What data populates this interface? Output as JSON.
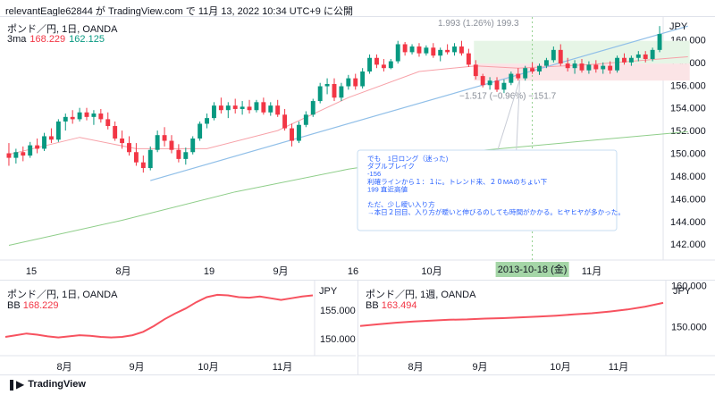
{
  "header": {
    "publish_line": "relevantEagle62844 が TradingView.com で 11月 13, 2022 10:34 UTC+9 に公開"
  },
  "main_pane": {
    "title": "ポンド／円, 1日, OANDA",
    "indicator_name": "3ma",
    "indicator_val1": "168.229",
    "indicator_val2": "162.125",
    "currency": "JPY",
    "measure_top": "1.993 (1.26%) 199.3",
    "measure_bottom": "−1.517 (−0.96%) −151.7",
    "crosshair_date": "2013-10-18 (金)",
    "note_lines": [
      "でも　1日ロング（迷った)",
      "ダブルブレイク",
      "-156",
      "利確ラインから１：１に。トレンド来、２０MAのちょい下",
      "199 直近高値",
      "",
      "ただ、少し曖い入り方",
      "→本日２回目、入り方が曖いと伸びるのしても時間がかかる。ヒヤヒヤが多かった。"
    ]
  },
  "sub_pane_left": {
    "title": "ポンド／円, 1日, OANDA",
    "indicator_name": "BB",
    "indicator_val": "168.229",
    "currency": "JPY"
  },
  "sub_pane_right": {
    "title": "ポンド／円, 1週, OANDA",
    "indicator_name": "BB",
    "indicator_val": "163.494",
    "currency": "JPY"
  },
  "footer": {
    "brand": "TradingView"
  },
  "colors": {
    "up": "#089981",
    "down": "#f23645",
    "ma_red": "#f7a1a8",
    "ma_green": "#8fce8a",
    "trend": "#90bfe8",
    "rect_green": "#e6f5e6",
    "rect_red": "#fbe4e6"
  },
  "chart_data": [
    {
      "type": "candlestick",
      "pane": "main",
      "y_axis": {
        "ticks": [
          142.0,
          144.0,
          146.0,
          148.0,
          150.0,
          152.0,
          154.0,
          156.0,
          158.0,
          160.0
        ],
        "range": [
          140.6,
          162.0
        ]
      },
      "x_tick_labels": [
        "15",
        "8月",
        "19",
        "9月",
        "16",
        "10月",
        "11月"
      ],
      "candles": [
        {
          "o": 150.0,
          "h": 150.9,
          "l": 148.9,
          "c": 149.6
        },
        {
          "o": 149.6,
          "h": 150.4,
          "l": 149.1,
          "c": 150.1
        },
        {
          "o": 150.1,
          "h": 150.6,
          "l": 149.3,
          "c": 149.8
        },
        {
          "o": 149.8,
          "h": 151.0,
          "l": 149.6,
          "c": 150.7
        },
        {
          "o": 150.7,
          "h": 151.3,
          "l": 150.0,
          "c": 150.4
        },
        {
          "o": 150.4,
          "h": 151.8,
          "l": 150.2,
          "c": 151.5
        },
        {
          "o": 151.5,
          "h": 152.2,
          "l": 150.9,
          "c": 151.2
        },
        {
          "o": 151.2,
          "h": 153.0,
          "l": 151.0,
          "c": 152.8
        },
        {
          "o": 152.8,
          "h": 153.5,
          "l": 152.0,
          "c": 153.2
        },
        {
          "o": 153.2,
          "h": 153.8,
          "l": 152.6,
          "c": 153.0
        },
        {
          "o": 153.0,
          "h": 154.0,
          "l": 152.8,
          "c": 153.6
        },
        {
          "o": 153.6,
          "h": 154.0,
          "l": 152.9,
          "c": 153.2
        },
        {
          "o": 153.2,
          "h": 153.8,
          "l": 152.5,
          "c": 153.5
        },
        {
          "o": 153.5,
          "h": 153.9,
          "l": 152.7,
          "c": 153.0
        },
        {
          "o": 153.0,
          "h": 153.6,
          "l": 152.1,
          "c": 152.4
        },
        {
          "o": 152.4,
          "h": 152.8,
          "l": 151.1,
          "c": 151.3
        },
        {
          "o": 151.3,
          "h": 152.0,
          "l": 150.4,
          "c": 150.9
        },
        {
          "o": 150.9,
          "h": 151.5,
          "l": 149.8,
          "c": 150.1
        },
        {
          "o": 150.1,
          "h": 150.9,
          "l": 148.9,
          "c": 149.2
        },
        {
          "o": 149.2,
          "h": 149.8,
          "l": 148.3,
          "c": 148.7
        },
        {
          "o": 148.7,
          "h": 150.6,
          "l": 148.5,
          "c": 150.3
        },
        {
          "o": 150.3,
          "h": 152.0,
          "l": 150.1,
          "c": 151.6
        },
        {
          "o": 151.6,
          "h": 152.3,
          "l": 150.6,
          "c": 151.1
        },
        {
          "o": 151.1,
          "h": 151.6,
          "l": 150.0,
          "c": 150.3
        },
        {
          "o": 150.3,
          "h": 150.8,
          "l": 149.2,
          "c": 149.5
        },
        {
          "o": 149.5,
          "h": 150.5,
          "l": 149.0,
          "c": 150.1
        },
        {
          "o": 150.1,
          "h": 151.5,
          "l": 149.9,
          "c": 151.3
        },
        {
          "o": 151.3,
          "h": 152.8,
          "l": 151.1,
          "c": 152.6
        },
        {
          "o": 152.6,
          "h": 153.5,
          "l": 152.2,
          "c": 153.1
        },
        {
          "o": 153.1,
          "h": 154.5,
          "l": 152.9,
          "c": 154.2
        },
        {
          "o": 154.2,
          "h": 154.9,
          "l": 153.5,
          "c": 153.8
        },
        {
          "o": 153.8,
          "h": 154.5,
          "l": 153.1,
          "c": 154.2
        },
        {
          "o": 154.2,
          "h": 154.8,
          "l": 153.5,
          "c": 153.9
        },
        {
          "o": 153.9,
          "h": 154.6,
          "l": 153.4,
          "c": 154.1
        },
        {
          "o": 154.1,
          "h": 154.7,
          "l": 153.5,
          "c": 153.8
        },
        {
          "o": 153.8,
          "h": 154.7,
          "l": 153.6,
          "c": 154.5
        },
        {
          "o": 154.5,
          "h": 154.9,
          "l": 153.4,
          "c": 153.6
        },
        {
          "o": 153.6,
          "h": 154.5,
          "l": 153.3,
          "c": 154.2
        },
        {
          "o": 154.2,
          "h": 154.7,
          "l": 153.2,
          "c": 153.4
        },
        {
          "o": 153.4,
          "h": 153.9,
          "l": 152.0,
          "c": 152.2
        },
        {
          "o": 152.2,
          "h": 152.6,
          "l": 150.6,
          "c": 151.1
        },
        {
          "o": 151.1,
          "h": 152.8,
          "l": 150.9,
          "c": 152.5
        },
        {
          "o": 152.5,
          "h": 153.7,
          "l": 152.3,
          "c": 153.4
        },
        {
          "o": 153.4,
          "h": 154.8,
          "l": 153.2,
          "c": 154.6
        },
        {
          "o": 154.6,
          "h": 156.2,
          "l": 154.4,
          "c": 155.9
        },
        {
          "o": 155.9,
          "h": 156.6,
          "l": 155.2,
          "c": 156.1
        },
        {
          "o": 156.1,
          "h": 156.6,
          "l": 154.6,
          "c": 154.9
        },
        {
          "o": 154.9,
          "h": 156.2,
          "l": 154.6,
          "c": 155.9
        },
        {
          "o": 155.9,
          "h": 156.9,
          "l": 155.6,
          "c": 156.6
        },
        {
          "o": 156.6,
          "h": 157.0,
          "l": 155.6,
          "c": 155.9
        },
        {
          "o": 155.9,
          "h": 157.5,
          "l": 155.7,
          "c": 157.2
        },
        {
          "o": 157.2,
          "h": 158.7,
          "l": 157.0,
          "c": 158.4
        },
        {
          "o": 158.4,
          "h": 158.7,
          "l": 157.5,
          "c": 157.8
        },
        {
          "o": 157.8,
          "h": 158.3,
          "l": 157.2,
          "c": 157.5
        },
        {
          "o": 157.5,
          "h": 158.3,
          "l": 157.4,
          "c": 158.1
        },
        {
          "o": 158.1,
          "h": 159.9,
          "l": 157.9,
          "c": 159.6
        },
        {
          "o": 159.6,
          "h": 159.8,
          "l": 158.6,
          "c": 158.9
        },
        {
          "o": 158.9,
          "h": 159.6,
          "l": 158.7,
          "c": 159.4
        },
        {
          "o": 159.4,
          "h": 159.7,
          "l": 158.5,
          "c": 158.8
        },
        {
          "o": 158.8,
          "h": 159.5,
          "l": 158.6,
          "c": 159.3
        },
        {
          "o": 159.3,
          "h": 159.7,
          "l": 158.4,
          "c": 158.6
        },
        {
          "o": 158.6,
          "h": 159.3,
          "l": 158.1,
          "c": 159.1
        },
        {
          "o": 159.1,
          "h": 159.6,
          "l": 158.7,
          "c": 158.9
        },
        {
          "o": 158.9,
          "h": 159.7,
          "l": 158.6,
          "c": 159.4
        },
        {
          "o": 159.4,
          "h": 159.9,
          "l": 158.6,
          "c": 158.8
        },
        {
          "o": 158.8,
          "h": 159.2,
          "l": 157.6,
          "c": 157.8
        },
        {
          "o": 157.8,
          "h": 158.2,
          "l": 156.5,
          "c": 156.8
        },
        {
          "o": 156.8,
          "h": 157.0,
          "l": 155.8,
          "c": 156.0
        },
        {
          "o": 156.0,
          "h": 156.7,
          "l": 155.6,
          "c": 156.4
        },
        {
          "o": 156.4,
          "h": 156.7,
          "l": 155.4,
          "c": 155.6
        },
        {
          "o": 155.6,
          "h": 156.5,
          "l": 155.3,
          "c": 156.2
        },
        {
          "o": 156.2,
          "h": 157.2,
          "l": 156.0,
          "c": 157.0
        },
        {
          "o": 157.0,
          "h": 157.5,
          "l": 156.4,
          "c": 156.6
        },
        {
          "o": 156.6,
          "h": 157.7,
          "l": 156.4,
          "c": 157.5
        },
        {
          "o": 157.5,
          "h": 158.0,
          "l": 157.0,
          "c": 157.2
        },
        {
          "o": 157.2,
          "h": 157.9,
          "l": 156.9,
          "c": 157.7
        },
        {
          "o": 157.7,
          "h": 158.4,
          "l": 157.5,
          "c": 158.2
        },
        {
          "o": 158.2,
          "h": 159.4,
          "l": 158.0,
          "c": 159.1
        },
        {
          "o": 159.1,
          "h": 159.6,
          "l": 157.7,
          "c": 157.9
        },
        {
          "o": 157.9,
          "h": 158.4,
          "l": 157.2,
          "c": 157.5
        },
        {
          "o": 157.5,
          "h": 158.2,
          "l": 157.0,
          "c": 157.9
        },
        {
          "o": 157.9,
          "h": 158.3,
          "l": 157.1,
          "c": 157.3
        },
        {
          "o": 157.3,
          "h": 158.1,
          "l": 157.0,
          "c": 157.8
        },
        {
          "o": 157.8,
          "h": 158.2,
          "l": 157.1,
          "c": 157.4
        },
        {
          "o": 157.4,
          "h": 158.0,
          "l": 157.0,
          "c": 157.7
        },
        {
          "o": 157.7,
          "h": 158.1,
          "l": 157.0,
          "c": 157.3
        },
        {
          "o": 157.3,
          "h": 158.6,
          "l": 157.1,
          "c": 158.4
        },
        {
          "o": 158.4,
          "h": 158.8,
          "l": 157.8,
          "c": 158.0
        },
        {
          "o": 158.0,
          "h": 158.6,
          "l": 157.7,
          "c": 158.4
        },
        {
          "o": 158.4,
          "h": 159.0,
          "l": 158.1,
          "c": 158.7
        },
        {
          "o": 158.7,
          "h": 159.0,
          "l": 158.0,
          "c": 158.3
        },
        {
          "o": 158.3,
          "h": 159.3,
          "l": 158.1,
          "c": 159.1
        },
        {
          "o": 159.1,
          "h": 161.2,
          "l": 158.9,
          "c": 160.5
        }
      ],
      "ma_red": [
        [
          0,
          149.9
        ],
        [
          10,
          151.4
        ],
        [
          18,
          150.4
        ],
        [
          28,
          150.4
        ],
        [
          38,
          152.0
        ],
        [
          48,
          154.9
        ],
        [
          58,
          157.2
        ],
        [
          66,
          157.7
        ],
        [
          72,
          157.5
        ],
        [
          82,
          157.8
        ],
        [
          92,
          158.3
        ],
        [
          96,
          158.5
        ]
      ],
      "ma_green": [
        [
          0,
          141.9
        ],
        [
          16,
          144.1
        ],
        [
          32,
          146.6
        ],
        [
          48,
          148.6
        ],
        [
          64,
          150.1
        ],
        [
          80,
          151.0
        ],
        [
          96,
          151.9
        ]
      ],
      "trendline": [
        [
          20,
          147.6
        ],
        [
          96,
          161.2
        ]
      ],
      "crosshair_index": 74
    },
    {
      "type": "line",
      "pane": "sub_left",
      "y_axis": {
        "ticks": [
          150.0,
          155.0
        ],
        "range": [
          147.0,
          160.2
        ]
      },
      "x_tick_labels": [
        "8月",
        "9月",
        "10月",
        "11月"
      ],
      "values": [
        150.3,
        150.6,
        150.9,
        150.7,
        150.4,
        150.2,
        150.4,
        150.6,
        150.5,
        150.3,
        150.2,
        150.3,
        150.6,
        151.2,
        152.2,
        153.4,
        154.4,
        155.3,
        156.4,
        157.3,
        157.7,
        157.6,
        157.3,
        157.2,
        157.4,
        157.1,
        156.8,
        157.1,
        157.4,
        157.6
      ]
    },
    {
      "type": "line",
      "pane": "sub_right",
      "y_axis": {
        "ticks": [
          150.0,
          160.0
        ],
        "range": [
          143.0,
          161.2
        ]
      },
      "x_tick_labels": [
        "8月",
        "9月",
        "10月",
        "11月"
      ],
      "values": [
        150.2,
        150.6,
        151.0,
        151.3,
        151.5,
        151.7,
        151.8,
        152.0,
        152.1,
        152.3,
        152.5,
        152.7,
        153.0,
        153.3,
        153.7,
        154.2,
        154.9,
        155.8
      ]
    }
  ]
}
